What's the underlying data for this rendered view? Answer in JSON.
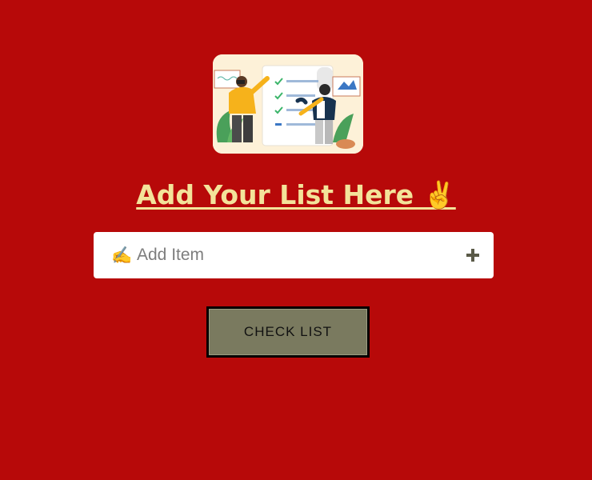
{
  "hero": {
    "image_icon": "people-checklist-illustration"
  },
  "heading": {
    "text": "Add Your List Here ✌️"
  },
  "add_item": {
    "prefix_emoji": "✍️",
    "placeholder": "Add Item",
    "value": "",
    "add_icon": "plus-icon"
  },
  "actions": {
    "check_list_label": "CHECK LIST"
  },
  "colors": {
    "background": "#b70909",
    "heading": "#f3e39a",
    "button": "#7a7a5f",
    "plus": "#5a5a48"
  }
}
